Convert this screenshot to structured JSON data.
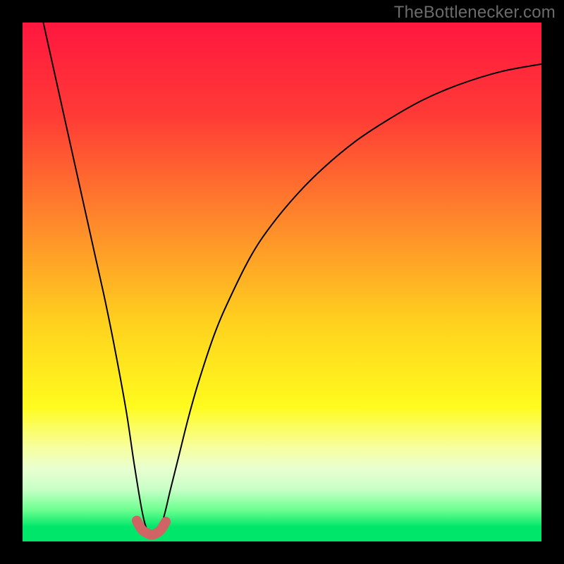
{
  "watermark": "TheBottlenecker.com",
  "chart_data": {
    "type": "line",
    "title": "",
    "xlabel": "",
    "ylabel": "",
    "xlim": [
      0,
      100
    ],
    "ylim": [
      0,
      100
    ],
    "gradient_stops": [
      {
        "offset": 0.0,
        "color": "#ff173f"
      },
      {
        "offset": 0.18,
        "color": "#ff3b36"
      },
      {
        "offset": 0.4,
        "color": "#ff8e2a"
      },
      {
        "offset": 0.58,
        "color": "#ffd21e"
      },
      {
        "offset": 0.74,
        "color": "#fffb1e"
      },
      {
        "offset": 0.82,
        "color": "#f7ffa0"
      },
      {
        "offset": 0.86,
        "color": "#e9ffd0"
      },
      {
        "offset": 0.9,
        "color": "#c7ffc7"
      },
      {
        "offset": 0.94,
        "color": "#6bff8f"
      },
      {
        "offset": 0.972,
        "color": "#00e66a"
      },
      {
        "offset": 1.0,
        "color": "#00e66a"
      }
    ],
    "series": [
      {
        "name": "bottleneck-curve",
        "color": "#000000",
        "width": 2,
        "x": [
          4.0,
          6,
          8,
          10,
          12,
          14,
          16,
          18,
          20,
          21.5,
          23,
          24,
          24.8,
          25.6,
          27,
          28.5,
          30,
          32,
          34,
          37,
          40,
          44,
          48,
          53,
          58,
          64,
          70,
          77,
          84,
          92,
          100
        ],
        "y": [
          100,
          91,
          82,
          73,
          64,
          55,
          46,
          36,
          25,
          15,
          6,
          2.2,
          1.4,
          1.7,
          4,
          10,
          16,
          24,
          31,
          40,
          47,
          55,
          61,
          67,
          72,
          77,
          81,
          85,
          88,
          90.5,
          92
        ]
      },
      {
        "name": "optimal-marker",
        "color": "#d06464",
        "width": 14,
        "linecap": "round",
        "x": [
          22.0,
          23.0,
          24.0,
          24.8,
          25.6,
          26.6,
          27.6
        ],
        "y": [
          4.0,
          2.3,
          1.6,
          1.3,
          1.5,
          2.2,
          3.8
        ]
      }
    ]
  }
}
